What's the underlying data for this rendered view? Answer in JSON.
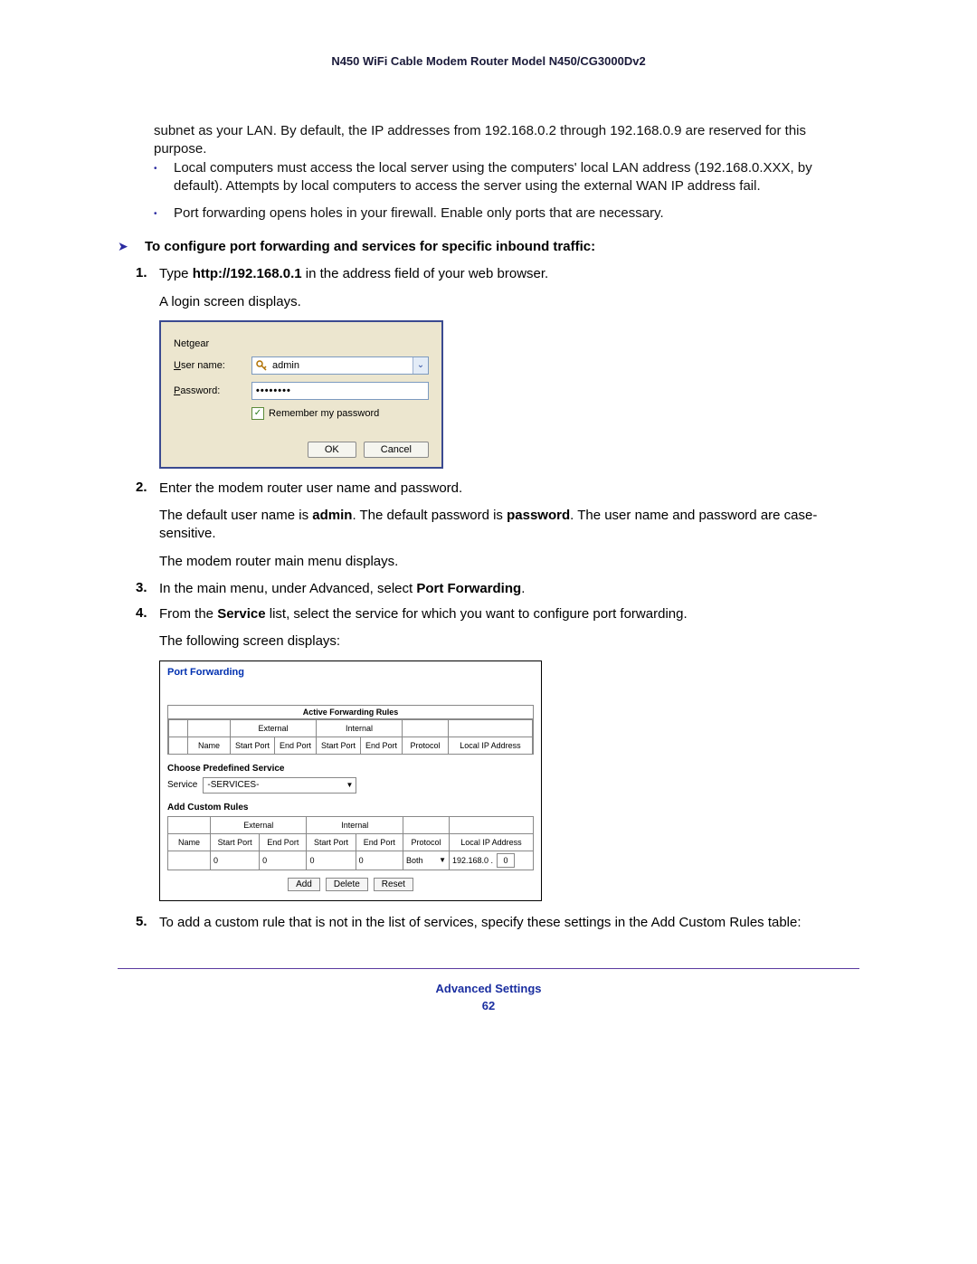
{
  "header": {
    "title": "N450 WiFi Cable Modem Router Model N450/CG3000Dv2"
  },
  "intro": {
    "para1": "subnet as your LAN. By default, the IP addresses from 192.168.0.2 through 192.168.0.9 are reserved for this purpose.",
    "bullet1": "Local computers must access the local server using the computers' local LAN address (192.168.0.XXX, by default). Attempts by local computers to access the server using the external WAN IP address fail.",
    "bullet2": "Port forwarding opens holes in your firewall. Enable only ports that are necessary."
  },
  "procedure": {
    "heading": "To configure port forwarding and services for specific inbound traffic:",
    "step1_a": "Type ",
    "step1_b": "http://192.168.0.1",
    "step1_c": " in the address field of your web browser.",
    "step1_sub": "A login screen displays.",
    "step2": "Enter the modem router user name and password.",
    "step2_sub1_a": "The default user name is ",
    "step2_sub1_b": "admin",
    "step2_sub1_c": ". The default password is ",
    "step2_sub1_d": "password",
    "step2_sub1_e": ". The user name and password are case-sensitive.",
    "step2_sub2": "The modem router main menu displays.",
    "step3_a": "In the main menu, under Advanced, select ",
    "step3_b": "Port Forwarding",
    "step3_c": ".",
    "step4_a": "From the ",
    "step4_b": "Service",
    "step4_c": " list, select the service for which you want to configure port forwarding.",
    "step4_sub": "The following screen displays:",
    "step5": "To add a custom rule that is not in the list of services, specify these settings in the Add Custom Rules table:"
  },
  "login": {
    "title": "Netgear",
    "user_label": "User name:",
    "user_value": "admin",
    "pass_label": "Password:",
    "pass_value": "••••••••",
    "remember": "Remember my password",
    "ok": "OK",
    "cancel": "Cancel"
  },
  "pf": {
    "title": "Port Forwarding",
    "active_rules": "Active Forwarding Rules",
    "external": "External",
    "internal": "Internal",
    "name": "Name",
    "start_port": "Start Port",
    "end_port": "End Port",
    "protocol": "Protocol",
    "local_ip": "Local IP Address",
    "choose_service": "Choose Predefined Service",
    "service_label": "Service",
    "service_value": "-SERVICES-",
    "add_custom": "Add Custom Rules",
    "row": {
      "sp_ext": "0",
      "ep_ext": "0",
      "sp_int": "0",
      "ep_int": "0",
      "proto": "Both",
      "ip_prefix": "192.168.0 .",
      "ip_last": "0"
    },
    "btn_add": "Add",
    "btn_delete": "Delete",
    "btn_reset": "Reset"
  },
  "footer": {
    "section": "Advanced Settings",
    "page": "62"
  }
}
